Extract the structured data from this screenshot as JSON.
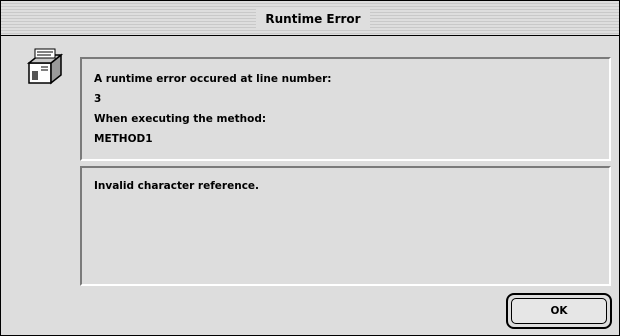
{
  "window": {
    "title": "Runtime Error"
  },
  "icon": {
    "name": "runtime-error-icon"
  },
  "message": {
    "line1": "A runtime error occured at line number:",
    "line_number": "3",
    "line3": "When executing the method:",
    "method": "METHOD1"
  },
  "detail": {
    "text": "Invalid character reference."
  },
  "buttons": {
    "ok_label": "OK"
  }
}
